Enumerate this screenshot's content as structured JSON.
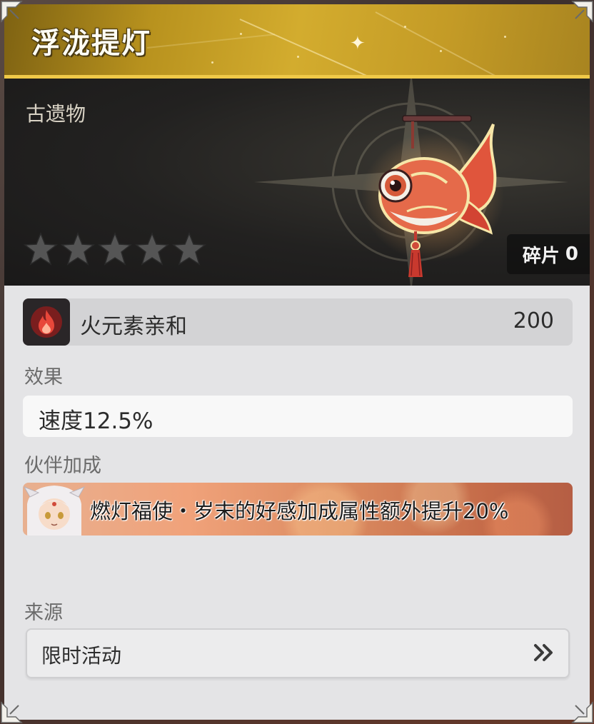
{
  "item": {
    "name": "浮泷提灯",
    "category": "古遗物",
    "rarity": 5,
    "rarity_max": 5,
    "fragment_label": "碎片",
    "fragment_count": "0"
  },
  "attribute": {
    "icon": "fire-element-icon",
    "label": "火元素亲和",
    "value": "200"
  },
  "effect": {
    "section_label": "效果",
    "text": "速度12.5%"
  },
  "partner_bonus": {
    "section_label": "伙伴加成",
    "text": "燃灯福使・岁末的好感加成属性额外提升20%"
  },
  "source": {
    "section_label": "来源",
    "text": "限时活动",
    "arrow_icon": "double-chevron-right-icon"
  },
  "colors": {
    "header_gold": "#c49b26",
    "art_dark": "#222120",
    "panel_bg": "#e4e4e6",
    "fire_red": "#d2342a"
  }
}
